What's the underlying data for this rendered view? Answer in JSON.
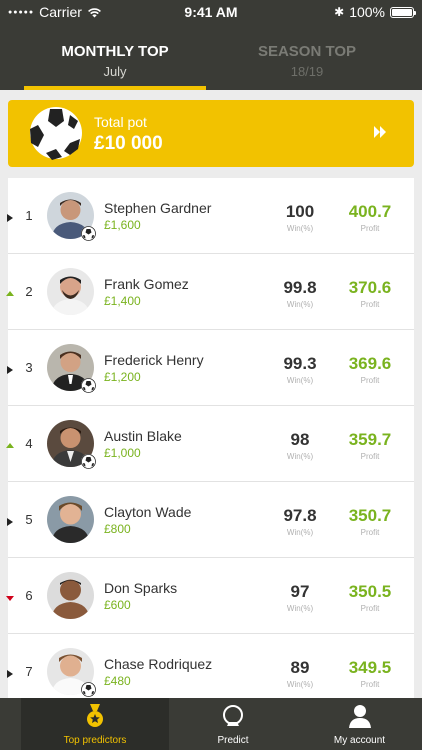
{
  "status_bar": {
    "carrier": "Carrier",
    "time": "9:41 AM",
    "battery": "100%"
  },
  "tabs": [
    {
      "title": "MONTHLY TOP",
      "subtitle": "July",
      "active": true
    },
    {
      "title": "SEASON TOP",
      "subtitle": "18/19",
      "active": false
    }
  ],
  "pot": {
    "label": "Total pot",
    "amount": "£10 000"
  },
  "captions": {
    "win": "Win(%)",
    "profit": "Profit"
  },
  "colors": {
    "accent": "#f2c200",
    "green": "#7ab31f",
    "dark": "#3a3b36",
    "trend_up": "#7ab31f",
    "trend_down": "#d0021b",
    "trend_same": "#222222"
  },
  "predictors": [
    {
      "rank": "1",
      "trend": "same",
      "name": "Stephen Gardner",
      "prize": "£1,600",
      "win": "100",
      "profit": "400.7",
      "badge": true
    },
    {
      "rank": "2",
      "trend": "up",
      "name": "Frank Gomez",
      "prize": "£1,400",
      "win": "99.8",
      "profit": "370.6",
      "badge": false
    },
    {
      "rank": "3",
      "trend": "same",
      "name": "Frederick Henry",
      "prize": "£1,200",
      "win": "99.3",
      "profit": "369.6",
      "badge": true
    },
    {
      "rank": "4",
      "trend": "up",
      "name": "Austin Blake",
      "prize": "£1,000",
      "win": "98",
      "profit": "359.7",
      "badge": true
    },
    {
      "rank": "5",
      "trend": "same",
      "name": "Clayton Wade",
      "prize": "£800",
      "win": "97.8",
      "profit": "350.7",
      "badge": false
    },
    {
      "rank": "6",
      "trend": "down",
      "name": "Don Sparks",
      "prize": "£600",
      "win": "97",
      "profit": "350.5",
      "badge": false
    },
    {
      "rank": "7",
      "trend": "same",
      "name": "Chase Rodriquez",
      "prize": "£480",
      "win": "89",
      "profit": "349.5",
      "badge": true
    }
  ],
  "nav": [
    {
      "label": "Top predictors",
      "icon": "medal-icon",
      "active": true
    },
    {
      "label": "Predict",
      "icon": "crystal-ball-icon",
      "active": false
    },
    {
      "label": "My account",
      "icon": "user-icon",
      "active": false
    }
  ]
}
